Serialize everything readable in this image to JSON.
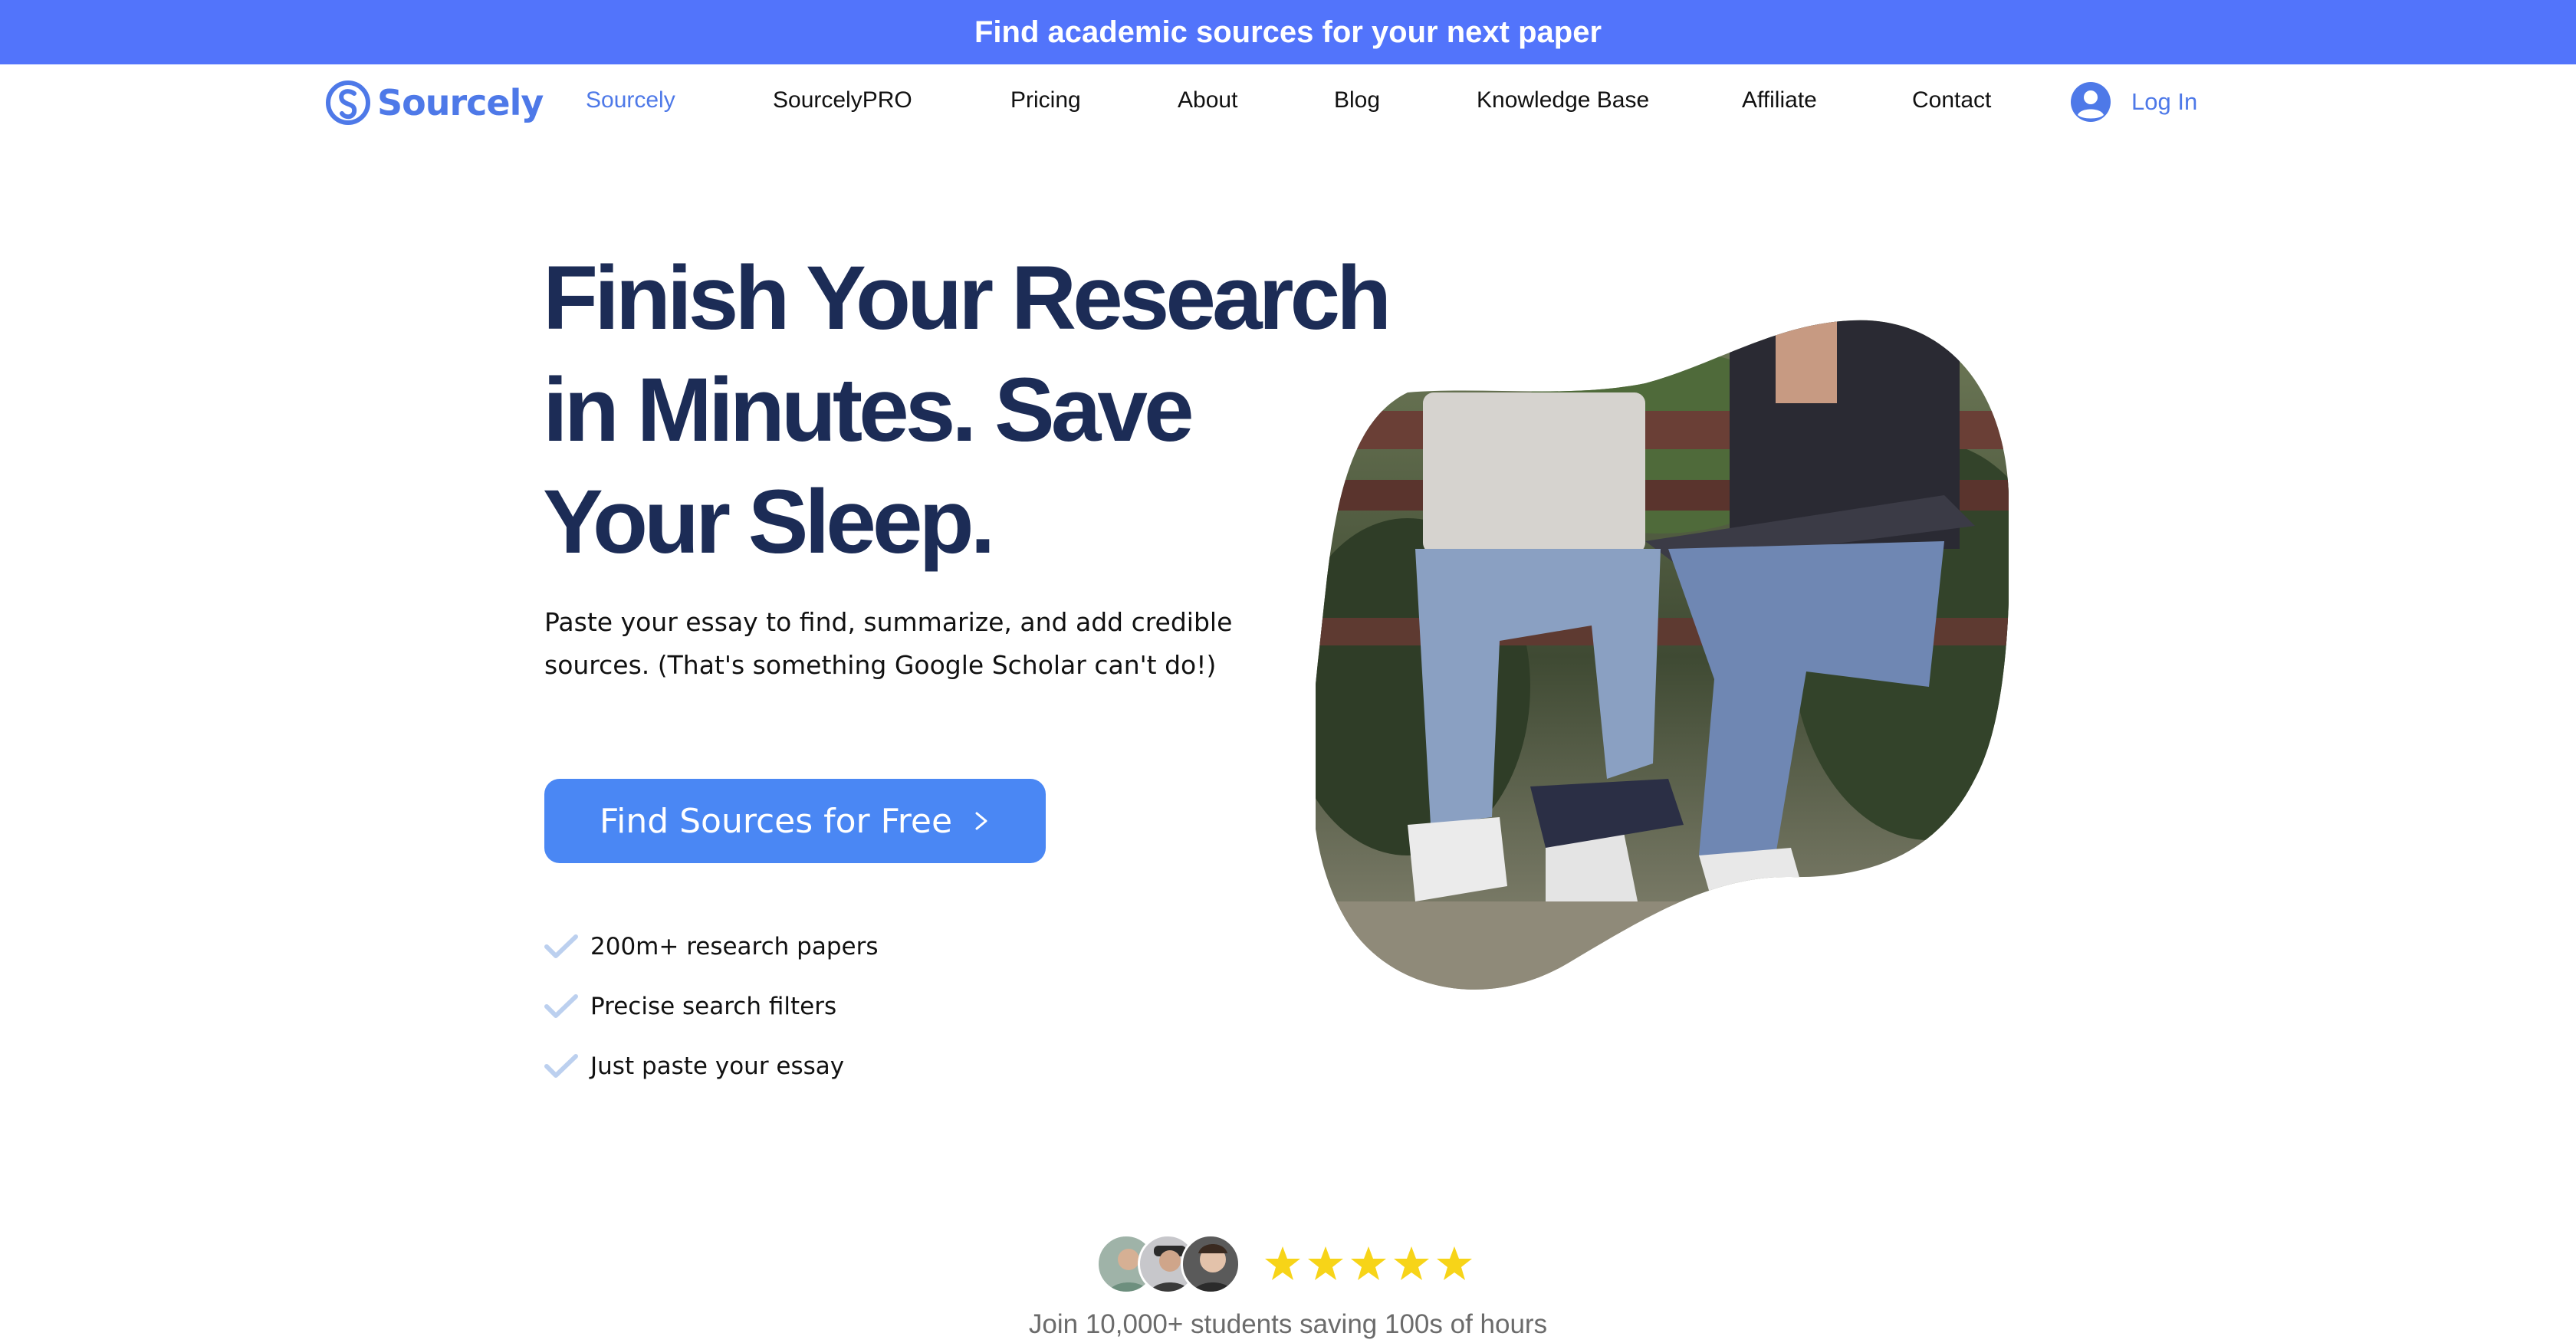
{
  "banner": {
    "text": "Find academic sources for your next paper"
  },
  "brand": {
    "name": "Sourcely",
    "accent": "#4e79e8",
    "banner_color": "#5274fb",
    "heading_color": "#1c2c56",
    "button_color": "#4a87f4",
    "star_color": "#f7d418"
  },
  "nav": {
    "items": [
      {
        "label": "Sourcely",
        "active": true
      },
      {
        "label": "SourcelyPRO"
      },
      {
        "label": "Pricing"
      },
      {
        "label": "About"
      },
      {
        "label": "Blog"
      },
      {
        "label": "Knowledge Base"
      },
      {
        "label": "Affiliate"
      },
      {
        "label": "Contact"
      }
    ],
    "login_label": "Log In"
  },
  "hero": {
    "headline_lines": [
      "Finish Your Research",
      "in Minutes. Save",
      "Your Sleep."
    ],
    "subtitle_lines": [
      "Paste your essay to find, summarize, and add credible",
      "sources. (That's something Google Scholar can't do!)"
    ],
    "cta_label": "Find Sources for Free",
    "features": [
      "200m+ research papers",
      "Precise search filters",
      "Just paste your essay"
    ]
  },
  "social_proof": {
    "rating_stars": 5,
    "text": "Join 10,000+ students saving 100s of hours"
  },
  "icons": {
    "logo": "sourcely-logo-icon",
    "login": "user-avatar-icon",
    "cta": "chevron-right-icon",
    "feature": "check-icon",
    "rating": "star-icon"
  }
}
